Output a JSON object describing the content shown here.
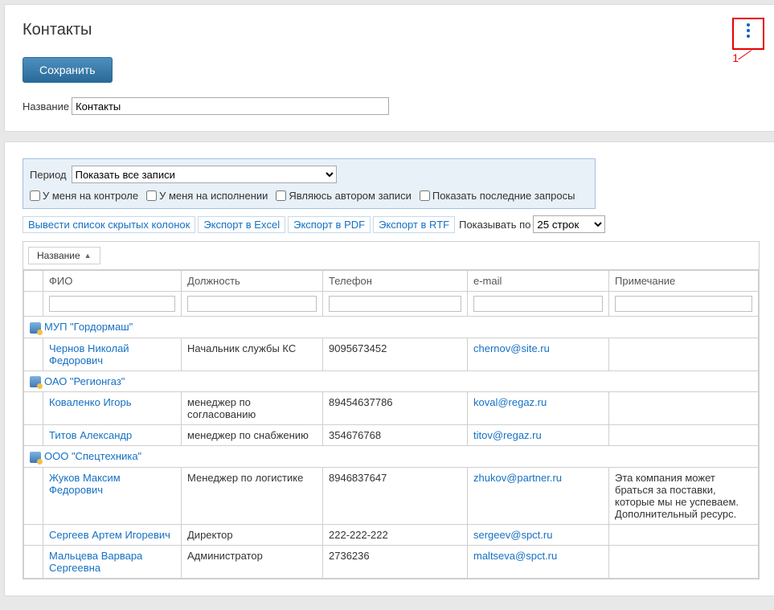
{
  "header": {
    "title": "Контакты",
    "save_label": "Сохранить",
    "name_label": "Название",
    "name_value": "Контакты",
    "annotation_label": "1"
  },
  "filter": {
    "period_label": "Период",
    "period_value": "Показать все записи",
    "cb_control": "У меня на контроле",
    "cb_exec": "У меня на исполнении",
    "cb_author": "Являюсь автором записи",
    "cb_recent": "Показать последние запросы"
  },
  "actions": {
    "show_hidden_cols": "Вывести список скрытых колонок",
    "export_excel": "Экспорт в Excel",
    "export_pdf": "Экспорт в PDF",
    "export_rtf": "Экспорт в RTF",
    "rows_per_page_label": "Показывать по",
    "rows_per_page_value": "25 строк"
  },
  "grid": {
    "group_label": "Название",
    "headers": {
      "fio": "ФИО",
      "position": "Должность",
      "phone": "Телефон",
      "email": "e-mail",
      "note": "Примечание"
    },
    "groups": [
      {
        "title": "МУП \"Гордормаш\"",
        "rows": [
          {
            "fio": "Чернов Николай Федорович",
            "position": "Начальник службы КС",
            "phone": "9095673452",
            "email": "chernov@site.ru",
            "note": ""
          }
        ]
      },
      {
        "title": "ОАО \"Регионгаз\"",
        "rows": [
          {
            "fio": "Коваленко Игорь",
            "position": "менеджер по согласованию",
            "phone": "89454637786",
            "email": "koval@regaz.ru",
            "note": ""
          },
          {
            "fio": "Титов Александр",
            "position": "менеджер по снабжению",
            "phone": "354676768",
            "email": "titov@regaz.ru",
            "note": ""
          }
        ]
      },
      {
        "title": "ООО \"Спецтехника\"",
        "rows": [
          {
            "fio": "Жуков Максим Федорович",
            "position": "Менеджер по логистике",
            "phone": "8946837647",
            "email": "zhukov@partner.ru",
            "note": "Эта компания может браться за поставки, которые мы не успеваем. Дополнительный ресурс."
          },
          {
            "fio": "Сергеев Артем Игоревич",
            "position": "Директор",
            "phone": "222-222-222",
            "email": "sergeev@spct.ru",
            "note": ""
          },
          {
            "fio": "Мальцева Варвара Сергеевна",
            "position": "Администратор",
            "phone": "2736236",
            "email": "maltseva@spct.ru",
            "note": ""
          }
        ]
      }
    ]
  }
}
